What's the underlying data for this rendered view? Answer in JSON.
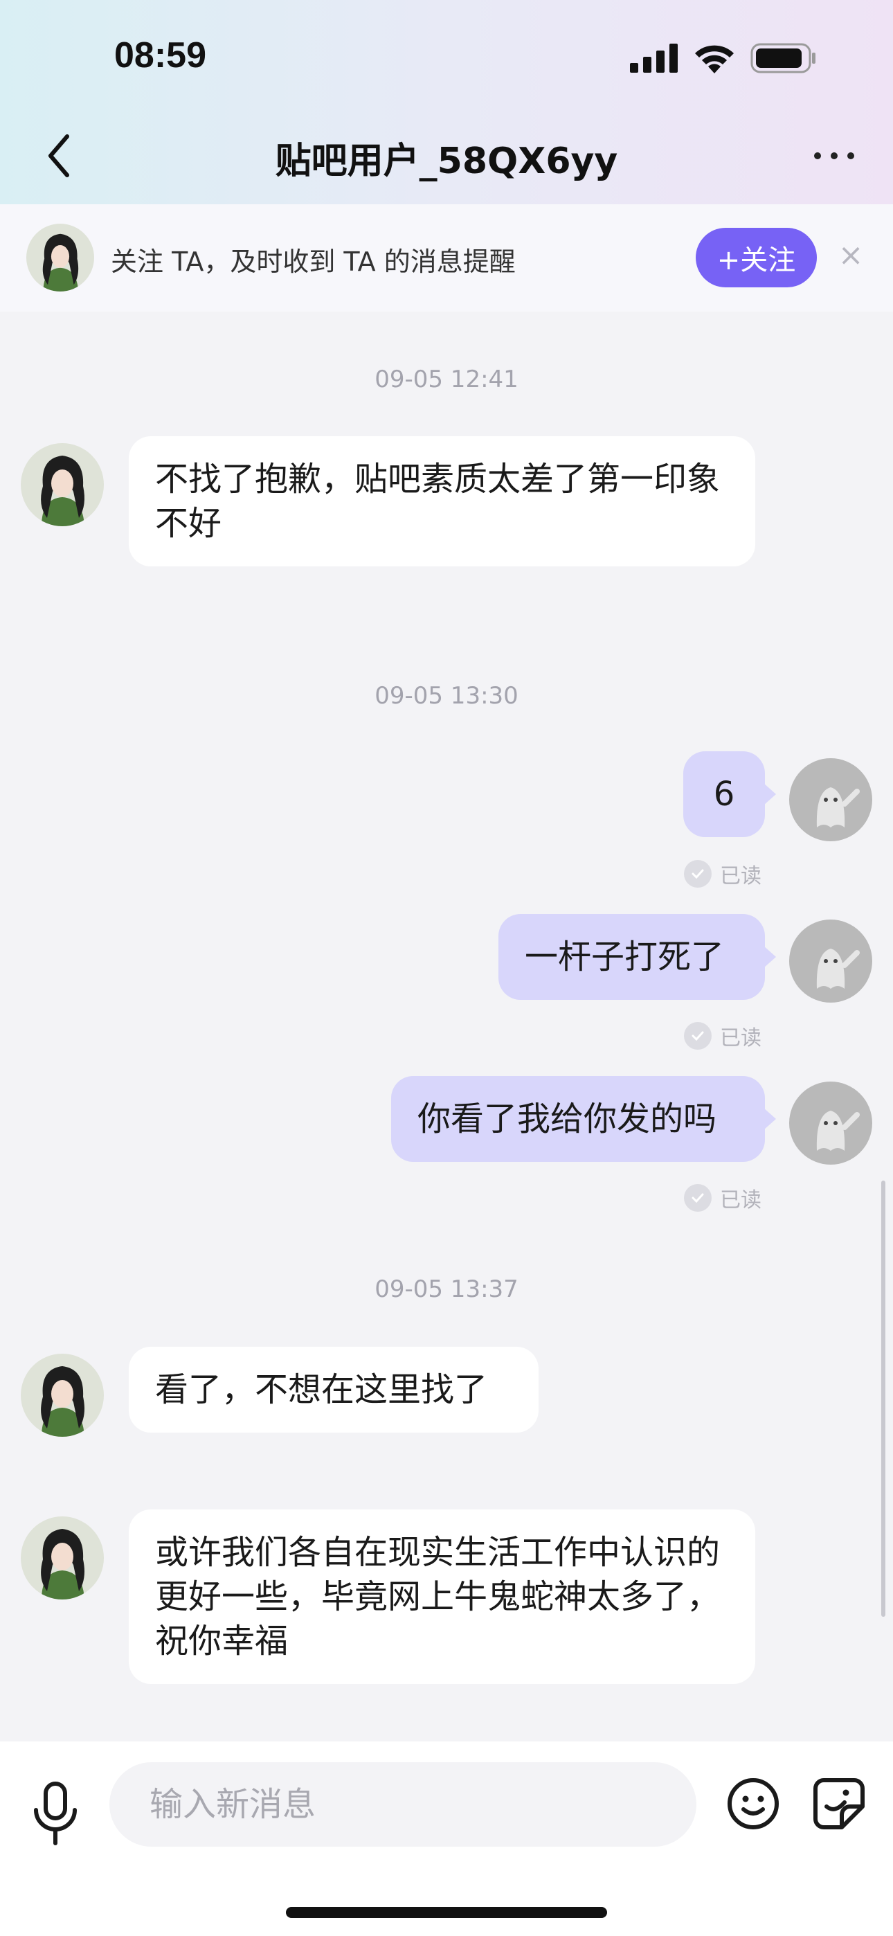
{
  "status_bar": {
    "time": "08:59"
  },
  "nav": {
    "title": "贴吧用户_58QX6yy"
  },
  "follow_banner": {
    "text": "关注 TA，及时收到 TA 的消息提醒",
    "button_label": "+关注",
    "close_symbol": "×"
  },
  "messages": [
    {
      "type": "timestamp",
      "text": "09-05  12:41"
    },
    {
      "type": "incoming",
      "text": "不找了抱歉，贴吧素质太差了第一印象不好"
    },
    {
      "type": "timestamp",
      "text": "09-05  13:30"
    },
    {
      "type": "outgoing",
      "text": "6",
      "status": "已读"
    },
    {
      "type": "outgoing",
      "text": "一杆子打死了",
      "status": "已读"
    },
    {
      "type": "outgoing",
      "text": "你看了我给你发的吗",
      "status": "已读"
    },
    {
      "type": "timestamp",
      "text": "09-05  13:37"
    },
    {
      "type": "incoming",
      "text": "看了，不想在这里找了"
    },
    {
      "type": "incoming",
      "text": "或许我们各自在现实生活工作中认识的更好一些，毕竟网上牛鬼蛇神太多了，祝你幸福"
    }
  ],
  "input": {
    "placeholder": "输入新消息"
  },
  "icons": {
    "back": "chevron-left-icon",
    "more": "more-dots-icon",
    "mic": "microphone-icon",
    "emoji": "emoji-icon",
    "sticker": "sticker-icon"
  },
  "colors": {
    "accent": "#7762f5",
    "outgoing_bubble": "#d8d6fb",
    "incoming_bubble": "#ffffff",
    "chat_background": "#f3f3f6"
  }
}
